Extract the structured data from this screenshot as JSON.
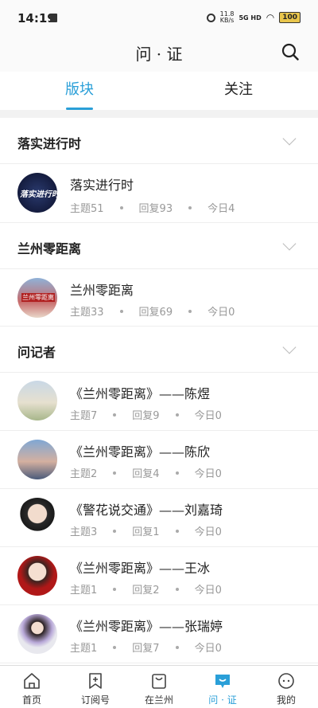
{
  "status_bar": {
    "time": "14:19",
    "speed_value": "11.8",
    "speed_unit": "KB/s",
    "signal": "5G HD",
    "battery": "100"
  },
  "header": {
    "title": "问 · 证"
  },
  "tabs": [
    {
      "label": "版块"
    },
    {
      "label": "关注"
    }
  ],
  "sections": [
    {
      "name": "落实进行时",
      "items": [
        {
          "title": "落实进行时",
          "topics": "主题51",
          "replies": "回复93",
          "today": "今日4"
        }
      ]
    },
    {
      "name": "兰州零距离",
      "items": [
        {
          "title": "兰州零距离",
          "topics": "主题33",
          "replies": "回复69",
          "today": "今日0"
        }
      ]
    },
    {
      "name": "问记者",
      "items": [
        {
          "title": "《兰州零距离》——陈煜",
          "topics": "主题7",
          "replies": "回复9",
          "today": "今日0"
        },
        {
          "title": "《兰州零距离》——陈欣",
          "topics": "主题2",
          "replies": "回复4",
          "today": "今日0"
        },
        {
          "title": "《警花说交通》——刘嘉琦",
          "topics": "主题3",
          "replies": "回复1",
          "today": "今日0"
        },
        {
          "title": "《兰州零距离》——王冰",
          "topics": "主题1",
          "replies": "回复2",
          "today": "今日0"
        },
        {
          "title": "《兰州零距离》——张瑞婷",
          "topics": "主题1",
          "replies": "回复7",
          "today": "今日0"
        }
      ]
    }
  ],
  "avatar_badge": "落实进行时",
  "avatar_badge2": "兰州零距离",
  "nav": [
    {
      "label": "首页"
    },
    {
      "label": "订阅号"
    },
    {
      "label": "在兰州"
    },
    {
      "label": "问 · 证"
    },
    {
      "label": "我的"
    }
  ],
  "colors": {
    "accent": "#2a9fd8"
  }
}
